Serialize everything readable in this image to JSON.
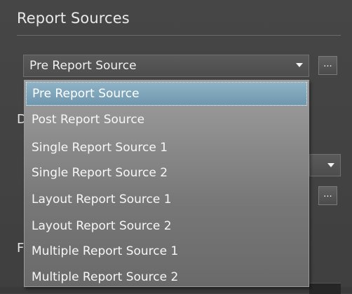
{
  "section": {
    "title": "Report Sources"
  },
  "report_source_select": {
    "value": "Pre Report Source",
    "options": [
      "Pre Report Source",
      "Post Report Source",
      "Single Report Source 1",
      "Single Report Source 2",
      "Layout Report Source 1",
      "Layout Report Source 2",
      "Multiple Report Source 1",
      "Multiple Report Source 2"
    ],
    "selected_index": 0
  },
  "ellipsis_label": "...",
  "partially_hidden_labels": {
    "label_d": "D",
    "label_p": "F"
  }
}
